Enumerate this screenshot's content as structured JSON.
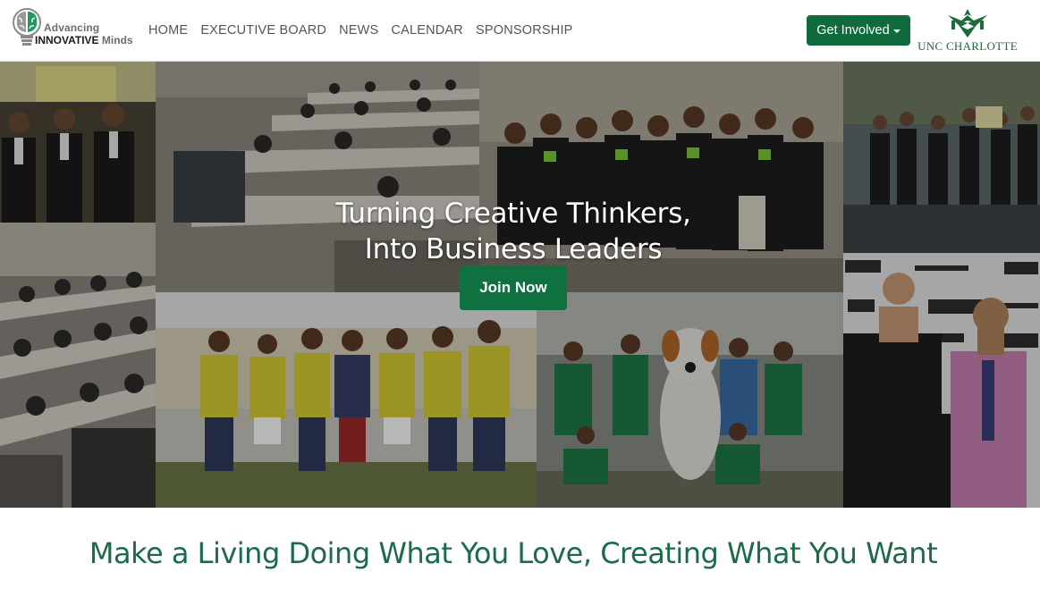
{
  "brand": {
    "line1": "Advancing",
    "line2_strong": "INNOVATIVE",
    "line2_rest": "Minds"
  },
  "nav": {
    "items": [
      {
        "label": "HOME"
      },
      {
        "label": "EXECUTIVE BOARD"
      },
      {
        "label": "NEWS"
      },
      {
        "label": "CALENDAR"
      },
      {
        "label": "SPONSORSHIP"
      }
    ]
  },
  "cta": {
    "get_involved": "Get Involved"
  },
  "university": {
    "label": "UNC CHARLOTTE"
  },
  "hero": {
    "line1": "Turning Creative Thinkers,",
    "line2": "Into Business Leaders",
    "button": "Join Now"
  },
  "tagline": "Make a Living Doing What You Love, Creating What You Want",
  "colors": {
    "brand_green": "#0f6b3c",
    "tagline_green": "#1c6b48"
  },
  "icons": {
    "brand_logo": "brain-lightbulb-icon",
    "university_logo": "unc-charlotte-crest-icon",
    "dropdown": "caret-down-icon"
  }
}
